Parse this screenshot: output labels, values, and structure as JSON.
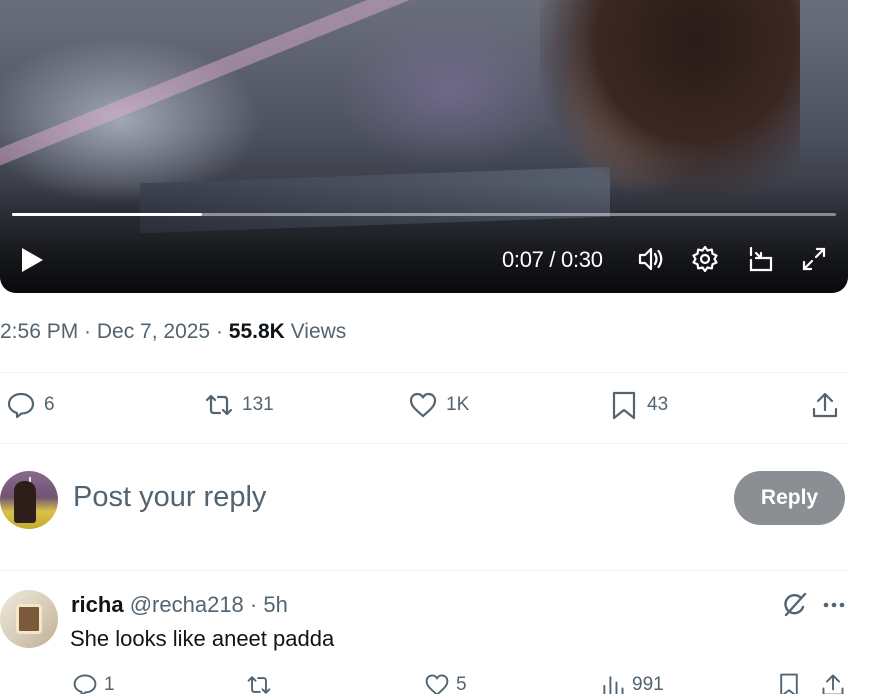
{
  "video": {
    "time_text": "0:07 / 0:30",
    "progress_fraction": 0.23,
    "icons": [
      "play-icon",
      "volume-icon",
      "settings-icon",
      "pip-icon",
      "fullscreen-icon"
    ]
  },
  "post_meta": {
    "time": "2:56 PM · Dec 7, 2025 · ",
    "views_count": "55.8K",
    "views_label": " Views"
  },
  "post_actions": {
    "replies": "6",
    "reposts": "131",
    "likes": "1K",
    "bookmarks": "43"
  },
  "composer": {
    "placeholder": "Post your reply",
    "reply_button": "Reply"
  },
  "comment": {
    "name": "richa",
    "handle": "@recha218",
    "separator": " · ",
    "time": "5h",
    "text": "She looks like aneet padda",
    "replies": "1",
    "reposts": "",
    "likes": "5",
    "views": "991"
  },
  "colors": {
    "secondary_text": "#536471",
    "primary_text": "#0f1419",
    "reply_button_bg": "#8b8f94",
    "divider": "#eff3f4"
  }
}
